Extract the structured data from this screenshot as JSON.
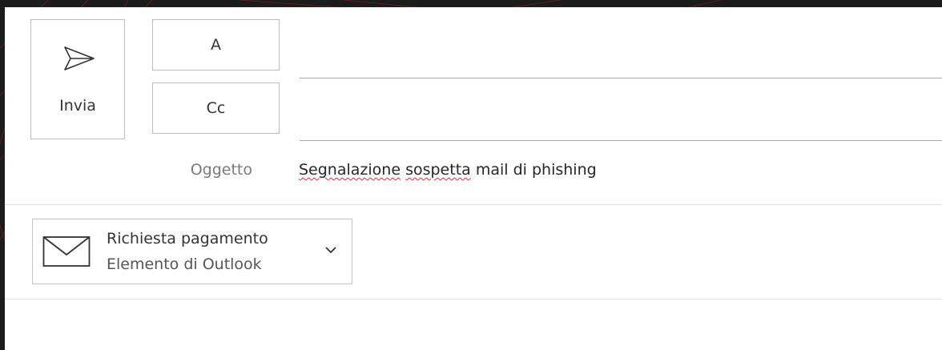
{
  "toolbar": {
    "send_label": "Invia",
    "send_icon": "send-icon"
  },
  "recipients": {
    "to_label": "A",
    "to_value": "",
    "cc_label": "Cc",
    "cc_value": ""
  },
  "subject": {
    "label": "Oggetto",
    "value_parts": [
      "Segnalazione",
      " ",
      "sospetta",
      " mail di phishing"
    ]
  },
  "attachment": {
    "name": "Richiesta pagamento",
    "type": "Elemento di Outlook",
    "icon": "envelope-icon",
    "menu_icon": "chevron-down-icon"
  },
  "colors": {
    "spellcheck_underline": "#d13438",
    "background": "#1c1c1c",
    "decor_line": "#6a1e22"
  }
}
